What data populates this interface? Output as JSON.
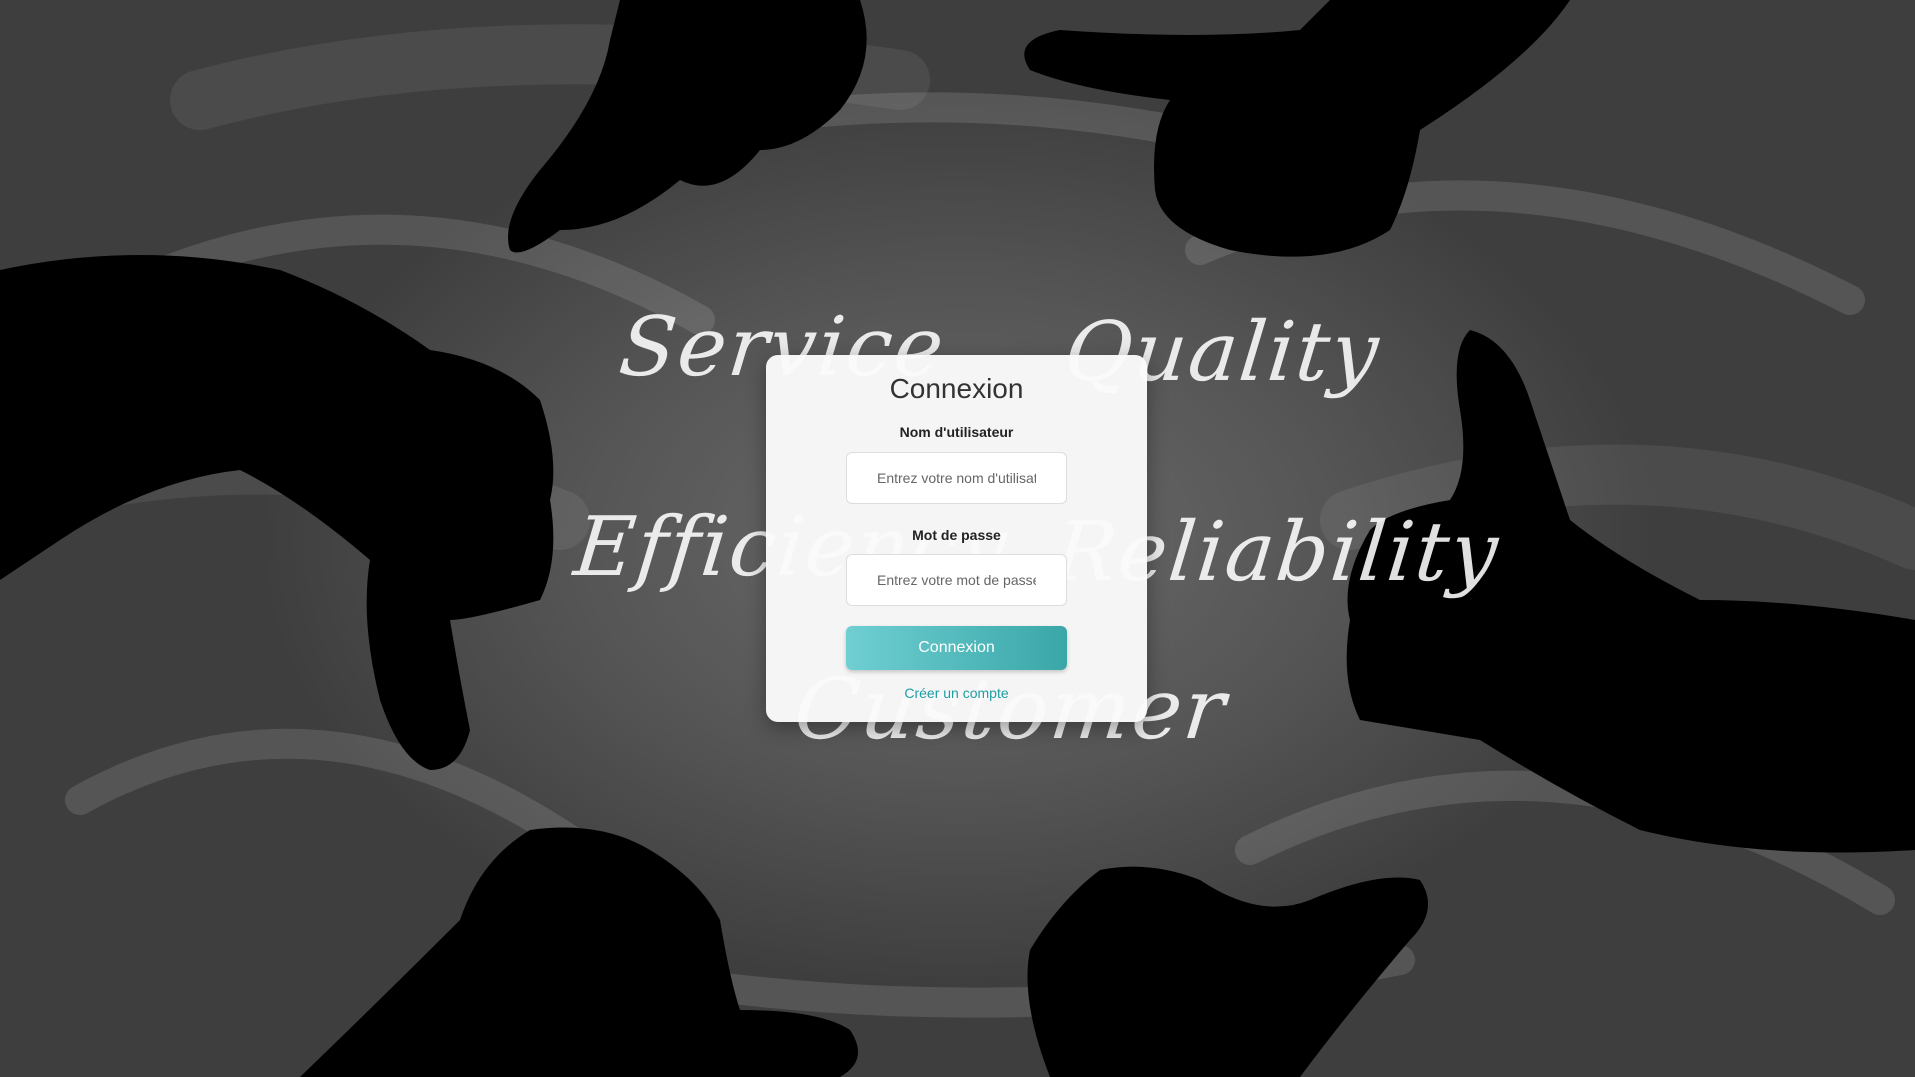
{
  "background": {
    "chalk_words": [
      "Service",
      "Quality",
      "Efficiency",
      "Reliability",
      "Customer"
    ]
  },
  "login": {
    "title": "Connexion",
    "username_label": "Nom d'utilisateur",
    "username_placeholder": "Entrez votre nom d'utilisateur",
    "password_label": "Mot de passe",
    "password_placeholder": "Entrez votre mot de passe",
    "submit_label": "Connexion",
    "signup_link": "Créer un compte"
  },
  "colors": {
    "accent": "#3aa6a8",
    "accent_light": "#6fcfd2",
    "link": "#1e9ea3",
    "card": "#fafafa"
  }
}
